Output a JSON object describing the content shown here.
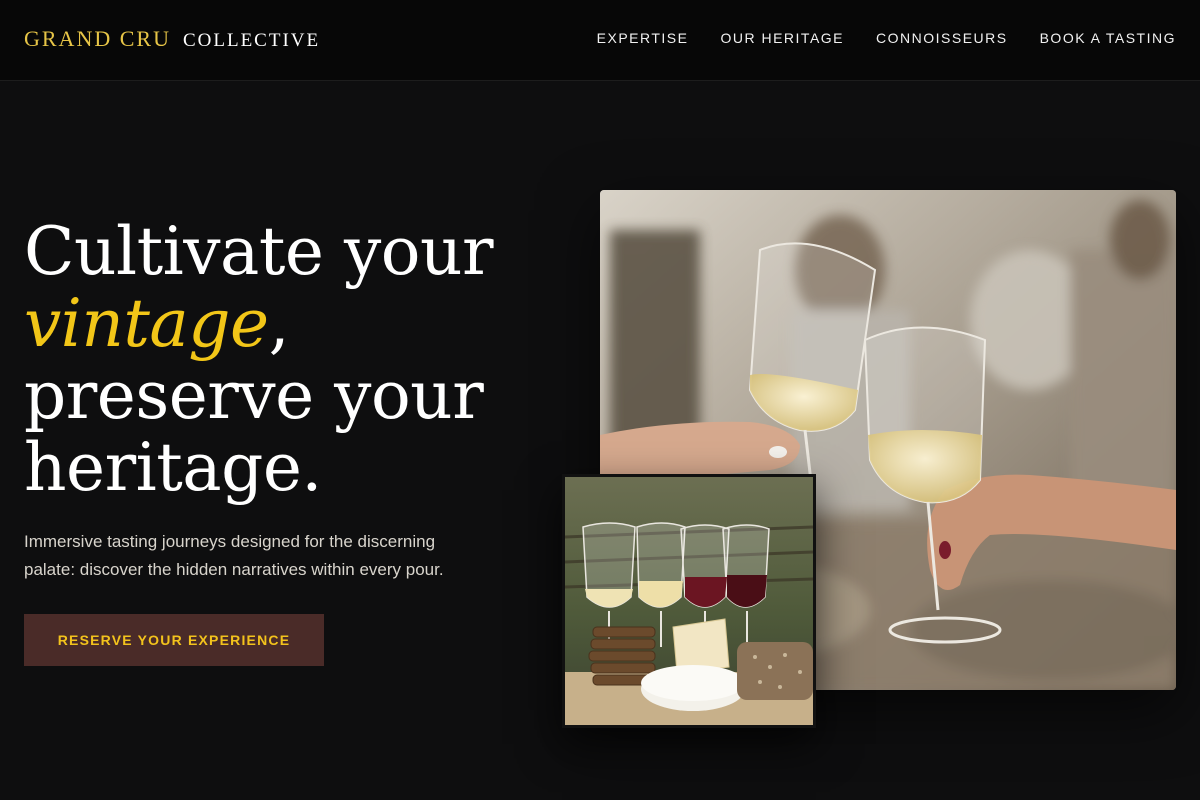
{
  "brand": {
    "name_main": "GRAND CRU",
    "name_sub": "COLLECTIVE"
  },
  "nav": {
    "items": [
      "EXPERTISE",
      "OUR HERITAGE",
      "CONNOISSEURS",
      "BOOK A TASTING"
    ]
  },
  "hero": {
    "title_line1": "Cultivate your",
    "title_accent": "vintage",
    "title_comma": ",",
    "title_line3": "preserve your",
    "title_line4": "heritage.",
    "subtitle": "Immersive tasting journeys designed for the discerning palate: discover the hidden narratives within every pour.",
    "cta_label": "RESERVE YOUR EXPERIENCE"
  },
  "colors": {
    "background": "#0e0e0f",
    "accent_gold": "#f2c618",
    "cta_background": "#4a2b28"
  }
}
